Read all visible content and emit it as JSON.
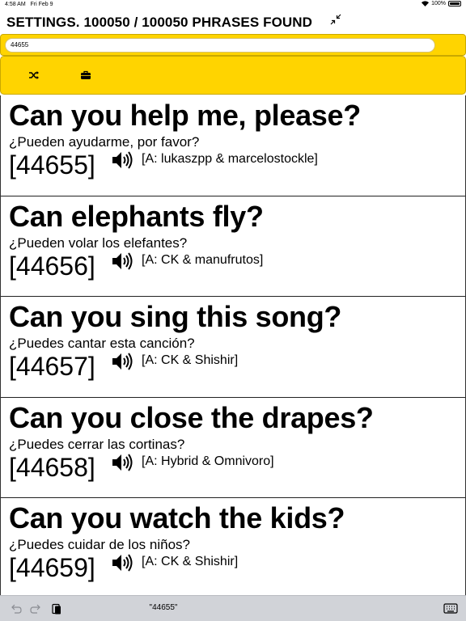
{
  "status": {
    "time": "4:58 AM",
    "date": "Fri Feb 9",
    "battery": "100%"
  },
  "header": {
    "title": "SETTINGS. 100050 / 100050 PHRASES FOUND"
  },
  "search": {
    "value": "44655"
  },
  "toolbar": {
    "icons": [
      "shuffle-icon",
      "briefcase-icon"
    ]
  },
  "phrases": [
    {
      "en": "Can you help me, please?",
      "es": "¿Pueden ayudarme, por favor?",
      "id": "[44655]",
      "attribution": "[A: lukaszpp & marcelostockle]"
    },
    {
      "en": "Can elephants fly?",
      "es": "¿Pueden volar los elefantes?",
      "id": "[44656]",
      "attribution": "[A: CK & manufrutos]"
    },
    {
      "en": "Can you sing this song?",
      "es": "¿Puedes cantar esta canción?",
      "id": "[44657]",
      "attribution": "[A: CK & Shishir]"
    },
    {
      "en": "Can you close the drapes?",
      "es": "¿Puedes cerrar las cortinas?",
      "id": "[44658]",
      "attribution": "[A: Hybrid & Omnivoro]"
    },
    {
      "en": "Can you watch the kids?",
      "es": "¿Puedes cuidar de los niños?",
      "id": "[44659]",
      "attribution": "[A: CK & Shishir]"
    }
  ],
  "keyboard_bar": {
    "suggestion": "\"44655\"",
    "icons": [
      "undo-icon",
      "redo-icon",
      "paste-icon",
      "keyboard-icon"
    ]
  },
  "colors": {
    "accent": "#ffd400",
    "keyboard_bar": "#d1d3d8"
  }
}
